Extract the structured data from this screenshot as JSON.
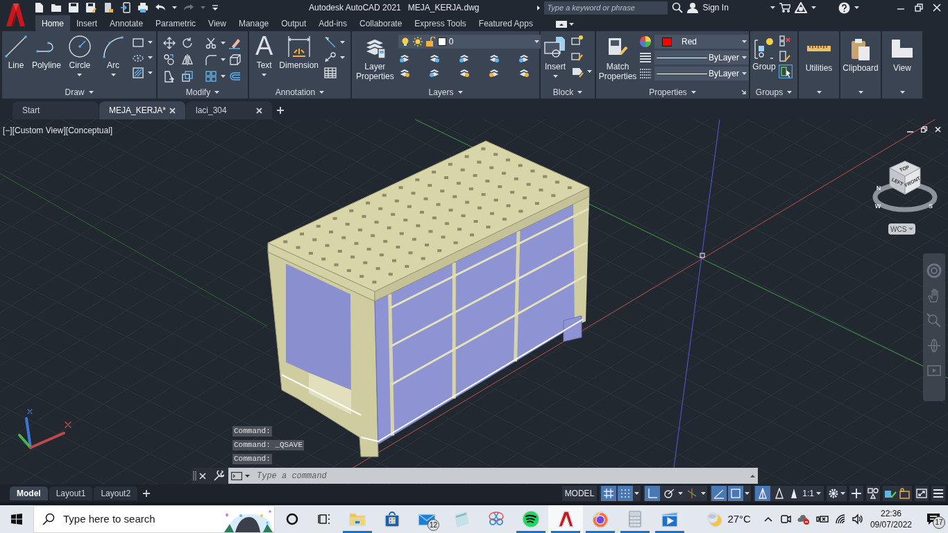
{
  "app": {
    "title": "Autodesk AutoCAD 2021",
    "file": "MEJA_KERJA.dwg"
  },
  "search": {
    "placeholder": "Type a keyword or phrase"
  },
  "account": {
    "label": "Sign In"
  },
  "ribbon_tabs": [
    {
      "label": "Home",
      "selected": true
    },
    {
      "label": "Insert",
      "selected": false
    },
    {
      "label": "Annotate",
      "selected": false
    },
    {
      "label": "Parametric",
      "selected": false
    },
    {
      "label": "View",
      "selected": false
    },
    {
      "label": "Manage",
      "selected": false
    },
    {
      "label": "Output",
      "selected": false
    },
    {
      "label": "Add-ins",
      "selected": false
    },
    {
      "label": "Collaborate",
      "selected": false
    },
    {
      "label": "Express Tools",
      "selected": false
    },
    {
      "label": "Featured Apps",
      "selected": false
    }
  ],
  "ribbon": {
    "draw": {
      "title": "Draw",
      "tools": [
        "Line",
        "Polyline",
        "Circle",
        "Arc"
      ]
    },
    "modify": {
      "title": "Modify"
    },
    "annotation": {
      "title": "Annotation",
      "text_glyph": "A",
      "tools": [
        "Text",
        "Dimension"
      ]
    },
    "layers": {
      "title": "Layers",
      "tools": [
        "Layer Properties"
      ],
      "current_layer": {
        "name": "0",
        "color": "#ffffff"
      }
    },
    "block": {
      "title": "Block",
      "tools": [
        "Insert"
      ]
    },
    "properties": {
      "title": "Properties",
      "tools": [
        "Match Properties"
      ],
      "color": {
        "name": "Red",
        "color": "#ff0000"
      },
      "lineweight": "ByLayer",
      "linetype": "ByLayer"
    },
    "groups": {
      "title": "Groups",
      "tools": [
        "Group"
      ]
    },
    "collapsed": [
      "Utilities",
      "Clipboard",
      "View"
    ]
  },
  "file_tabs": [
    {
      "label": "Start",
      "selected": false,
      "closable": false
    },
    {
      "label": "MEJA_KERJA*",
      "selected": true,
      "closable": true
    },
    {
      "label": "laci_304",
      "selected": false,
      "closable": true
    }
  ],
  "viewport": {
    "controls": "[−][Custom View][Conceptual]"
  },
  "viewcube": {
    "faces": [
      "TOP",
      "LEFT",
      "FRONT"
    ],
    "compass": [
      "N",
      "W",
      "S"
    ],
    "ucs": "WCS"
  },
  "command_history": [
    "Command:",
    "Command: _QSAVE",
    "Command:"
  ],
  "command_line": {
    "placeholder": "Type a command"
  },
  "layout_tabs": [
    {
      "label": "Model",
      "selected": true
    },
    {
      "label": "Layout1",
      "selected": false
    },
    {
      "label": "Layout2",
      "selected": false
    }
  ],
  "status_bar": {
    "space": "MODEL",
    "scale": "1:1",
    "toggles": [
      {
        "on": true
      },
      {
        "on": true
      },
      {
        "on": true
      },
      {
        "on": false
      },
      {
        "on": false
      },
      {
        "on": true
      },
      {
        "on": true
      },
      {
        "on": true
      },
      {
        "on": false
      }
    ]
  },
  "taskbar": {
    "search": {
      "placeholder": "Type here to search"
    },
    "apps": [
      {
        "running": true,
        "selected": false
      },
      {
        "running": false,
        "selected": false
      },
      {
        "running": false,
        "selected": false,
        "badge": "12"
      },
      {
        "running": false,
        "selected": false
      },
      {
        "running": false,
        "selected": false
      },
      {
        "running": true,
        "selected": false
      },
      {
        "running": true,
        "selected": true
      },
      {
        "running": true,
        "selected": false
      },
      {
        "running": true,
        "selected": false
      },
      {
        "running": true,
        "selected": false
      }
    ],
    "weather": "27°C",
    "time": "22:36",
    "date": "09/07/2022",
    "notifications": "17"
  }
}
